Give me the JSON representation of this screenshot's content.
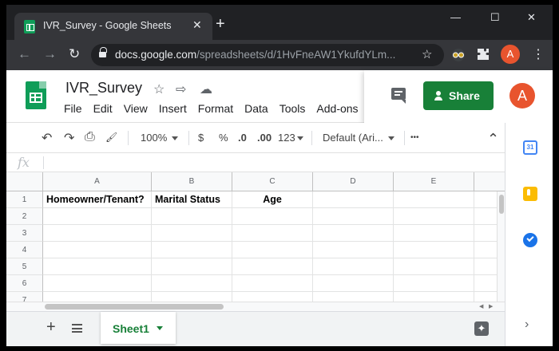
{
  "browser": {
    "tab_title": "IVR_Survey - Google Sheets",
    "tab_close": "✕",
    "new_tab": "+",
    "window_controls": {
      "minimize": "—",
      "maximize": "☐",
      "close": "✕"
    },
    "nav": {
      "back": "←",
      "forward": "→",
      "reload": "↻"
    },
    "url_host": "docs.google.com",
    "url_path": "/spreadsheets/d/1HvFneAW1YkufdYLm...",
    "bookmark_star": "☆",
    "profile_initial": "A",
    "menu": "⋮"
  },
  "doc": {
    "title": "IVR_Survey",
    "menus": [
      "File",
      "Edit",
      "View",
      "Insert",
      "Format",
      "Data",
      "Tools",
      "Add-ons"
    ],
    "header_icons": {
      "star": "☆",
      "move": "⇨",
      "cloud": "☁"
    },
    "share_label": "Share",
    "avatar_initial": "A"
  },
  "toolbar": {
    "undo": "↶",
    "redo": "↷",
    "print": "⎙",
    "paint": "🖌",
    "zoom": "100%",
    "currency": "$",
    "percent": "%",
    "dec_decrease": ".0",
    "dec_increase": ".00",
    "more_formats": "123",
    "font": "Default (Ari...",
    "more": "•••",
    "collapse": "⌃"
  },
  "formula_bar": {
    "fx": "fx",
    "value": ""
  },
  "grid": {
    "columns": [
      "A",
      "B",
      "C",
      "D",
      "E"
    ],
    "rows": [
      "1",
      "2",
      "3",
      "4",
      "5",
      "6",
      "7"
    ],
    "cells": {
      "A1": "Homeowner/Tenant?",
      "B1": "Marital Status",
      "C1": "Age"
    }
  },
  "sheets": {
    "add": "+",
    "active_tab": "Sheet1",
    "explore": "✦"
  },
  "side_panel": {
    "calendar_day": "31",
    "expand": "›"
  },
  "colors": {
    "sheets_green": "#0f9d58",
    "share_green": "#188038",
    "avatar_orange": "#e8542e",
    "chrome_dark": "#202124"
  }
}
